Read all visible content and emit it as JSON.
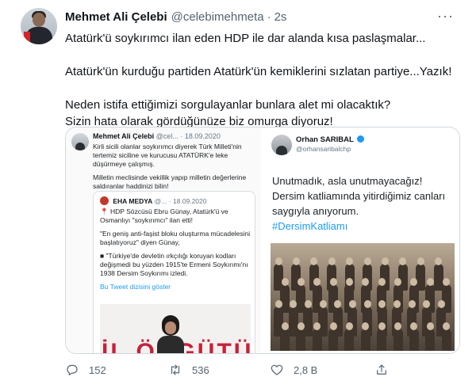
{
  "author": {
    "name": "Mehmet Ali Çelebi",
    "handle": "@celebimehmeta",
    "separator": "·",
    "time": "2s"
  },
  "more_icon": "ellipsis-icon",
  "tweet_lines": [
    "Atatürk'ü soykırımcı ilan eden HDP ile dar alanda kısa paslaşmalar...",
    "Atatürk'ün kurduğu partiden Atatürk'ün kemiklerini sızlatan partiye...Yazık!",
    "Neden istifa ettiğimizi sorgulayanlar bunlara alet mi olacaktık?",
    "Sizin hata olarak gördüğünüze biz omurga diyoruz!"
  ],
  "left_card": {
    "author": "Mehmet Ali Çelebi",
    "meta": "@cel... · 18.09.2020",
    "text1": "Kirli sicili olanlar soykırımcı diyerek Türk Milleti'nin tertemiz siciline ve kurucusu ATATÜRK'e leke düşürmeye çalışmış.",
    "text2": "Milletin meclisinde vekillik yapıp milletin değerlerine saldıranlar haddinizi bilin!",
    "quoted": {
      "author": "EHA MEDYA",
      "meta": "@... · 18.09.2020",
      "text1": "📍 HDP Sözcüsü Ebru Günay, Atatürk'ü ve Osmanlıyı \"soykırımcı\" ilan etti!",
      "text2": "\"En geniş anti-faşist bloku oluşturma mücadelesini başlatıyoruz\" diyen Günay,",
      "text3": "■ \"Türkiye'de devletin ırkçılığı koruyan kodları değişmedi bu yüzden 1915'te Ermeni Soykırımı'nı 1938 Dersim Soykırımı izledi.",
      "link": "Bu Tweet dizisini göster",
      "image_text": "İL ÖRGÜTÜ"
    }
  },
  "right_card": {
    "author": "Orhan SARIBAL",
    "handle": "@orhansaribalchp",
    "verified_icon": "verified-badge-icon",
    "text1": "Unutmadık, asla unutmayacağız!",
    "text2": "Dersim katliamında yitirdiğimiz canları saygıyla anıyorum.",
    "hashtag": "#DersimKatliamı"
  },
  "actions": {
    "reply_count": "152",
    "retweet_count": "536",
    "like_count": "2,8 B"
  },
  "colors": {
    "text": "#0f1419",
    "muted": "#536471",
    "link": "#1d9bf0",
    "border": "#cfd9de"
  }
}
